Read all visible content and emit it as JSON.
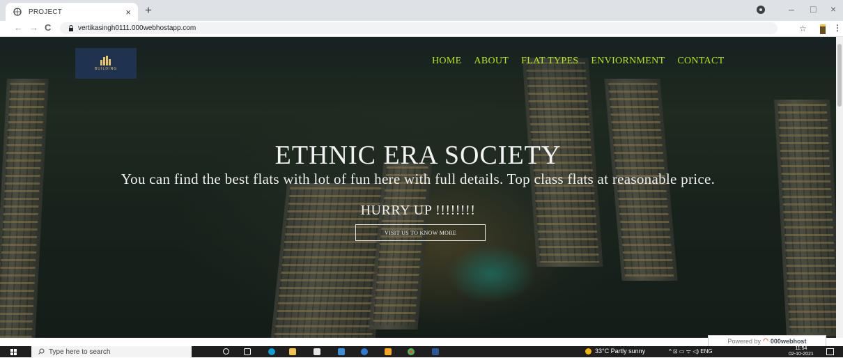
{
  "browser": {
    "tab_title": "PROJECT",
    "tab_close": "×",
    "new_tab": "+",
    "url": "vertikasingh0111.000webhostapp.com",
    "minimize": "–",
    "maximize": "□",
    "close": "×",
    "back": "←",
    "forward": "→",
    "reload": "C",
    "bookmark": "☆",
    "menu": "⋮"
  },
  "logo": {
    "text": "BUILDING"
  },
  "nav": {
    "items": [
      {
        "label": "HOME"
      },
      {
        "label": "ABOUT"
      },
      {
        "label": "FLAT TYPES"
      },
      {
        "label": "ENVIORNMENT"
      },
      {
        "label": "CONTACT"
      }
    ]
  },
  "hero": {
    "title": "ETHNIC ERA SOCIETY",
    "tagline": "You can find the best flats with lot of fun here with full details. Top class flats at reasonable price.",
    "hurry": "HURRY UP !!!!!!!!",
    "cta_label": "VISIT US TO KNOW MORE"
  },
  "powered": {
    "prefix": "Powered by",
    "brand": "000webhost"
  },
  "taskbar": {
    "search_placeholder": "Type here to search",
    "weather": "33°C  Partly sunny",
    "tray": "^  ⊡  ▭  ᯤ  ◁)  ENG",
    "time": "11:54",
    "date": "02-10-2021"
  },
  "colors": {
    "nav": "#b5e61d",
    "logo_bg": "#1f3350",
    "taskbar": "#1f1f1f"
  }
}
